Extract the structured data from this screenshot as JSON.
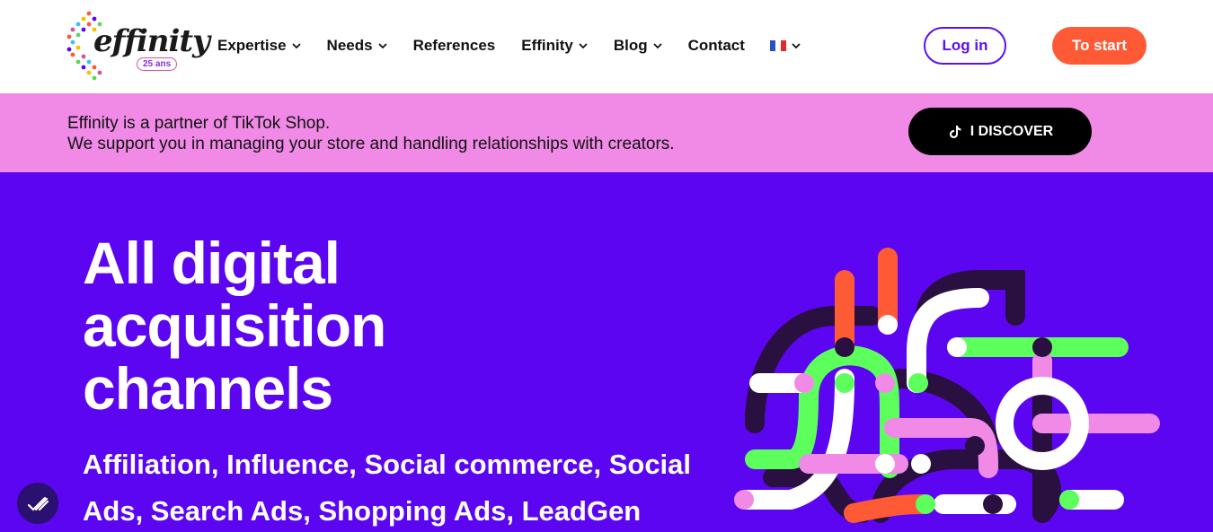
{
  "logo": {
    "name": "effinity",
    "badge": "25 ans"
  },
  "nav": {
    "items": [
      {
        "label": "Expertise",
        "dropdown": true
      },
      {
        "label": "Needs",
        "dropdown": true
      },
      {
        "label": "References",
        "dropdown": false
      },
      {
        "label": "Effinity",
        "dropdown": true
      },
      {
        "label": "Blog",
        "dropdown": true
      },
      {
        "label": "Contact",
        "dropdown": false
      }
    ],
    "language_icon": "french-flag-icon"
  },
  "header": {
    "login_label": "Log in",
    "start_label": "To start"
  },
  "banner": {
    "line1": "Effinity is a partner of TikTok Shop.",
    "line2": "We support you in managing your store and handling relationships with creators.",
    "button_label": "I DISCOVER",
    "button_icon": "tiktok-icon"
  },
  "hero": {
    "title_line1": "All digital",
    "title_line2": "acquisition",
    "title_line3": "channels",
    "subtitle": "Affiliation, Influence, Social commerce, Social Ads, Search Ads, Shopping Ads, LeadGen"
  },
  "colors": {
    "primary": "#5b05f0",
    "accent_orange": "#ff5a36",
    "banner_pink": "#f08ae6",
    "green": "#5cff5c",
    "dark": "#2a1040"
  }
}
